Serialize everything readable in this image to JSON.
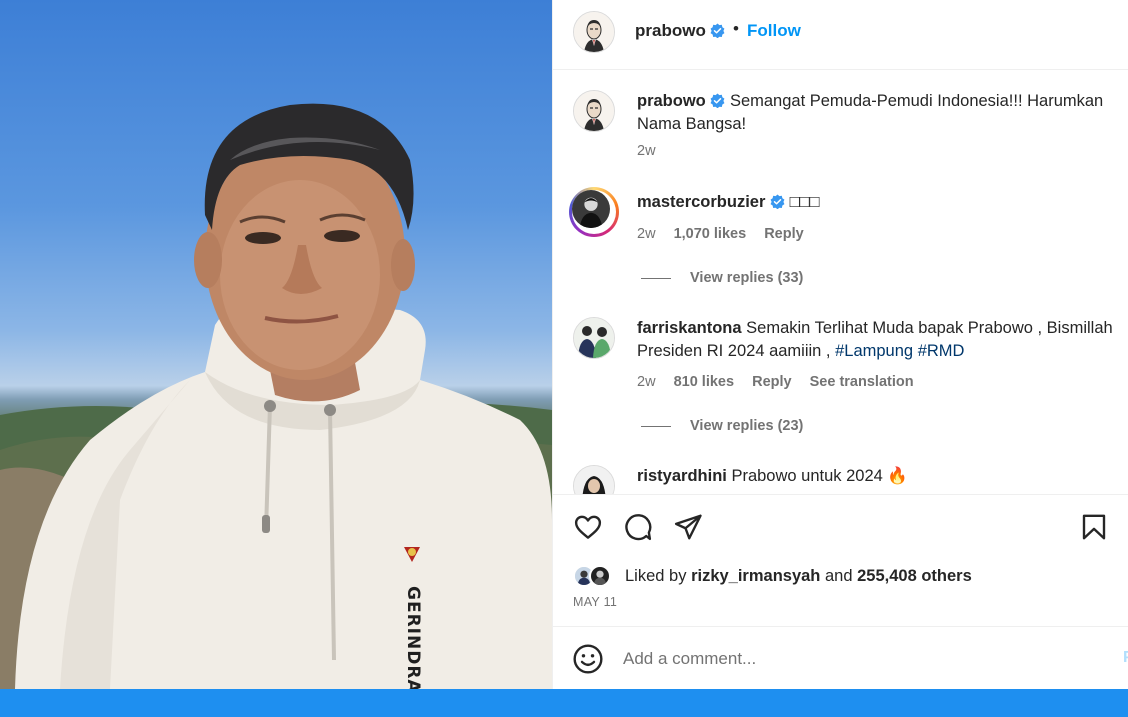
{
  "post": {
    "author": "prabowo",
    "follow_label": "Follow",
    "dot": "•",
    "caption": "Semangat Pemuda-Pemudi Indonesia!!! Harumkan Nama Bangsa!",
    "caption_time": "2w",
    "hoodie_text": "GERINDRA"
  },
  "comments": [
    {
      "user": "mastercorbuzier",
      "verified": true,
      "text": "□□□",
      "time": "2w",
      "likes": "1,070 likes",
      "reply": "Reply",
      "view_replies": "View replies (33)"
    },
    {
      "user": "farriskantona",
      "verified": false,
      "text": "Semakin Terlihat Muda bapak Prabowo , Bismillah Presiden RI 2024 aamiiin , ",
      "tags": [
        "#Lampung",
        "#RMD"
      ],
      "time": "2w",
      "likes": "810 likes",
      "reply": "Reply",
      "translation": "See translation",
      "view_replies": "View replies (23)"
    },
    {
      "user": "ristyardhini",
      "verified": false,
      "text": "Prabowo untuk 2024 🔥"
    }
  ],
  "likes": {
    "prefix": "Liked by",
    "user": "rizky_irmansyah",
    "and": "and",
    "count": "255,408 others"
  },
  "date": "MAY 11",
  "comment_input": {
    "placeholder": "Add a comment...",
    "post_label": "P"
  },
  "icons": {
    "like": "heart-icon",
    "comment": "comment-icon",
    "share": "share-icon",
    "save": "bookmark-icon",
    "emoji": "emoji-icon",
    "verified": "verified-badge-icon"
  },
  "colors": {
    "accent": "#0095f6",
    "verified": "#3897f0",
    "muted": "#737373",
    "hashtag": "#00376b",
    "bottom_bar": "#1e8ff0"
  }
}
